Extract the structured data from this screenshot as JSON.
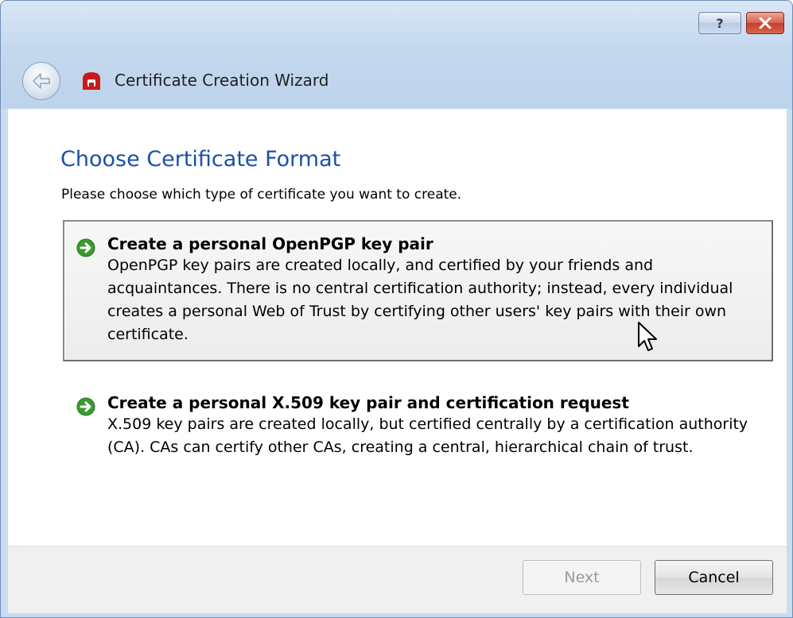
{
  "window": {
    "title": "Certificate Creation Wizard",
    "help_label": "?",
    "close_label": "X"
  },
  "page": {
    "title": "Choose Certificate Format",
    "intro": "Please choose which type of certificate you want to create."
  },
  "choices": [
    {
      "title": "Create a personal OpenPGP key pair",
      "description": "OpenPGP key pairs are created locally, and certified by your friends and acquaintances. There is no central certification authority; instead, every individual creates a personal Web of Trust by certifying other users' key pairs with their own certificate."
    },
    {
      "title": "Create a personal X.509 key pair and certification request",
      "description": "X.509 key pairs are created locally, but certified centrally by a certification authority (CA). CAs can certify other CAs, creating a central, hierarchical chain of trust."
    }
  ],
  "buttons": {
    "next": "Next",
    "cancel": "Cancel"
  },
  "colors": {
    "title_blue": "#1e4fa8",
    "arrow_green": "#3a9a2f",
    "close_red": "#c2402c"
  },
  "icons": {
    "back": "back-arrow-icon",
    "app": "kleopatra-app-icon",
    "choice": "green-arrow-icon",
    "pointer": "mouse-cursor-icon"
  }
}
